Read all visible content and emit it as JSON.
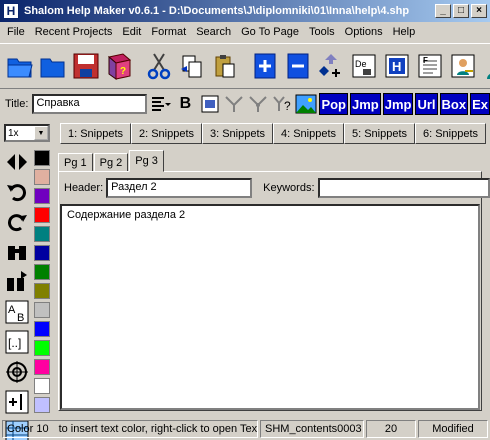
{
  "window": {
    "app_icon": "H",
    "title": "Shalom Help Maker v0.6.1 - D:\\Documents\\J\\diplomniki\\01\\Inna\\help\\4.shp",
    "minimize_icon": "minimize-icon",
    "maximize_icon": "maximize-icon",
    "close_icon": "close-icon"
  },
  "menu": [
    {
      "label": "File"
    },
    {
      "label": "Recent Projects"
    },
    {
      "label": "Edit"
    },
    {
      "label": "Format"
    },
    {
      "label": "Search"
    },
    {
      "label": "Go To Page"
    },
    {
      "label": "Tools"
    },
    {
      "label": "Options"
    },
    {
      "label": "Help"
    }
  ],
  "toolbar": {
    "icons": [
      "open-folder-icon",
      "new-folder-icon",
      "save-icon",
      "help-book-icon",
      "cut-icon",
      "copy-icon",
      "paste-icon",
      "add-page-icon",
      "remove-page-icon",
      "move-page-icon",
      "de-icon",
      "h-icon",
      "f-icon",
      "user-key-icon",
      "user-icon"
    ]
  },
  "toolbar2": {
    "title_label": "Title:",
    "title_value": "Справка",
    "bold_label": "B",
    "pop_label": "Pop",
    "jmp_label": "Jmp",
    "jmp2_label": "Jmp",
    "url_label": "Url",
    "box_label": "Box",
    "ex_label": "Ex"
  },
  "zoom": {
    "value": "1x"
  },
  "snippets": [
    "1: Snippets",
    "2: Snippets",
    "3: Snippets",
    "4: Snippets",
    "5: Snippets",
    "6: Snippets"
  ],
  "page_tabs": [
    "Pg 1",
    "Pg 2",
    "Pg 3"
  ],
  "active_page_tab": "Pg 3",
  "editor": {
    "header_label": "Header:",
    "header_value": "Раздел 2",
    "keywords_label": "Keywords:",
    "keywords_value": "",
    "content": "Содержание раздела 2"
  },
  "palette_colors": [
    "#000000",
    "#e0b0a0",
    "#7000c0",
    "#ff0000",
    "#008080",
    "#0000a0",
    "#008000",
    "#808000",
    "#c0c0c0",
    "#0000ff",
    "#00ff00",
    "#ff00a0",
    "#ffffff",
    "#c0c0ff"
  ],
  "status": {
    "color": "Color 10",
    "hint": "to insert text color, right-click to open Text Color",
    "contents": "SHM_contents0003",
    "number": "20",
    "state": "Modified"
  }
}
